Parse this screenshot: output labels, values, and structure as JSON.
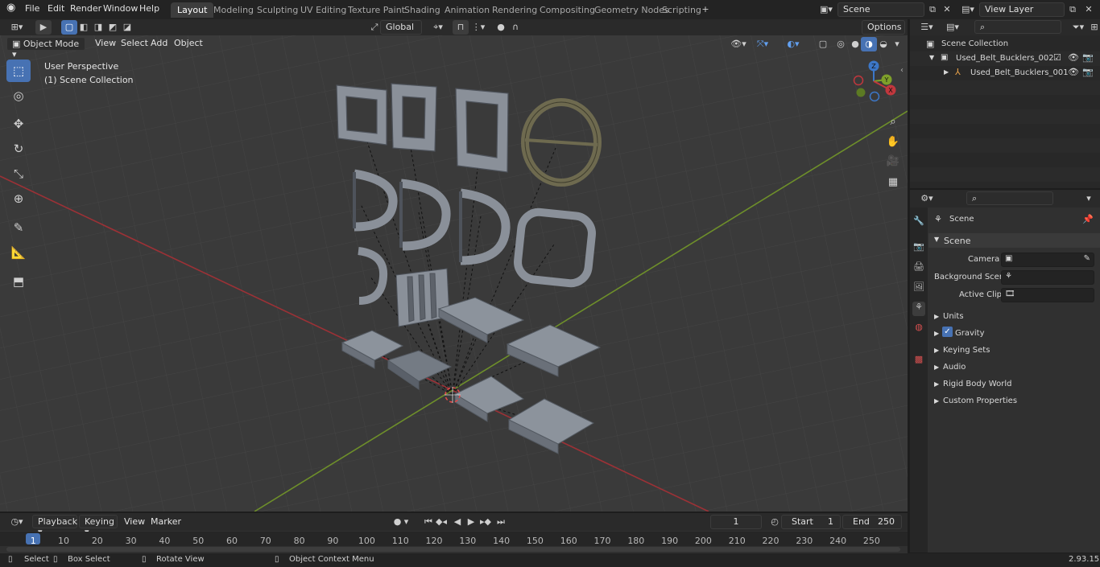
{
  "colors": {
    "accent": "#4772b3",
    "x_axis": "#c1373d",
    "y_axis": "#7ea02a"
  },
  "top_menu": [
    "File",
    "Edit",
    "Render",
    "Window",
    "Help"
  ],
  "workspace_tabs": [
    "Layout",
    "Modeling",
    "Sculpting",
    "UV Editing",
    "Texture Paint",
    "Shading",
    "Animation",
    "Rendering",
    "Compositing",
    "Geometry Nodes",
    "Scripting"
  ],
  "active_tab": "Layout",
  "scene_name": "Scene",
  "view_layer": "View Layer",
  "viewport": {
    "transform_orientation": "Global",
    "options_label": "Options",
    "mode": "Object Mode",
    "menus": [
      "View",
      "Select",
      "Add",
      "Object"
    ],
    "overlay_text_1": "User Perspective",
    "overlay_text_2": "(1) Scene Collection",
    "gizmo_labels": {
      "z": "Z",
      "y": "Y",
      "x": "X"
    }
  },
  "outliner": {
    "root": "Scene Collection",
    "items": [
      {
        "label": "Used_Belt_Bucklers_002",
        "level": 1
      },
      {
        "label": "Used_Belt_Bucklers_001",
        "level": 2
      }
    ]
  },
  "properties": {
    "header": "Scene",
    "section": "Scene",
    "fields": [
      {
        "label": "Camera",
        "value": ""
      },
      {
        "label": "Background Scene",
        "value": ""
      },
      {
        "label": "Active Clip",
        "value": ""
      }
    ],
    "panels": [
      "Units",
      "Gravity",
      "Keying Sets",
      "Audio",
      "Rigid Body World",
      "Custom Properties"
    ],
    "gravity_checked": true
  },
  "timeline": {
    "menus": [
      "Playback",
      "Keying",
      "View",
      "Marker"
    ],
    "current_frame": "1",
    "start_label": "Start",
    "start_value": "1",
    "end_label": "End",
    "end_value": "250",
    "ruler": [
      "1",
      "10",
      "20",
      "30",
      "40",
      "50",
      "60",
      "70",
      "80",
      "90",
      "100",
      "110",
      "120",
      "130",
      "140",
      "150",
      "160",
      "170",
      "180",
      "190",
      "200",
      "210",
      "220",
      "230",
      "240",
      "250"
    ]
  },
  "status_bar": {
    "items": [
      "Select",
      "Box Select",
      "Rotate View",
      "Object Context Menu"
    ],
    "version": "2.93.15"
  }
}
